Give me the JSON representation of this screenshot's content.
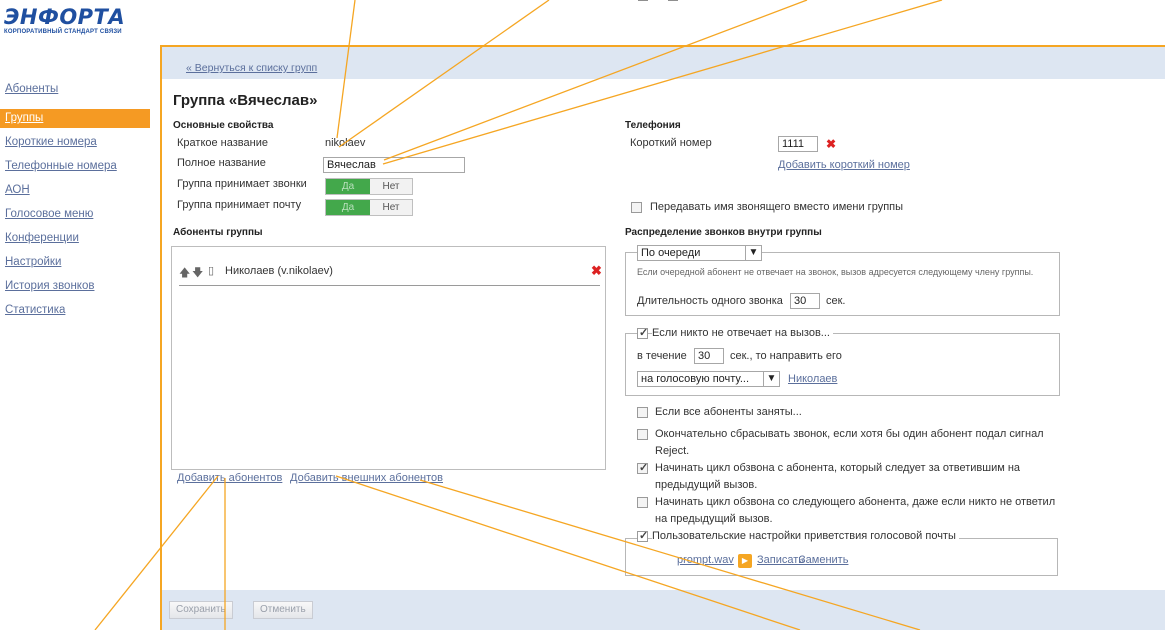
{
  "brand": {
    "logo_text": "ЭНФОРТА",
    "logo_tagline": "КОРПОРАТИВНЫЙ СТАНДАРТ СВЯЗИ",
    "accent_color": "#f5a623",
    "brand_color": "#1f4fa0"
  },
  "sidebar": {
    "items": [
      {
        "label": "Абоненты",
        "active": false
      },
      {
        "label": "Группы",
        "active": true
      },
      {
        "label": "Короткие номера",
        "active": false
      },
      {
        "label": "Телефонные номера",
        "active": false
      },
      {
        "label": "АОН",
        "active": false
      },
      {
        "label": "Голосовое меню",
        "active": false
      },
      {
        "label": "Конференции",
        "active": false
      },
      {
        "label": "Настройки",
        "active": false
      },
      {
        "label": "История звонков",
        "active": false
      },
      {
        "label": "Статистика",
        "active": false
      }
    ]
  },
  "topbar": {
    "back_link": "« Вернуться к списку групп"
  },
  "page": {
    "title": "Группа «Вячеслав»"
  },
  "basic": {
    "section_title": "Основные свойства",
    "short_name_label": "Краткое название",
    "short_name_value": "nikolaev",
    "full_name_label": "Полное название",
    "full_name_value": "Вячеслав",
    "accepts_calls_label": "Группа принимает звонки",
    "accepts_mail_label": "Группа принимает почту",
    "toggle_yes": "Да",
    "toggle_no": "Нет"
  },
  "members": {
    "section_title": "Абоненты группы",
    "list": [
      {
        "name": "Николаев (v.nikolaev)"
      }
    ],
    "add_members_link": "Добавить абонентов",
    "add_external_link": "Добавить внешних абонентов"
  },
  "telephony": {
    "section_title": "Телефония",
    "short_number_label": "Короткий номер",
    "short_number_value": "1111",
    "add_short_number_link": "Добавить короткий номер",
    "pass_caller_name_label": "Передавать имя звонящего вместо имени группы"
  },
  "distribution": {
    "section_title": "Распределение звонков внутри группы",
    "mode_value": "По очереди",
    "mode_note": "Если очередной абонент не отвечает на звонок, вызов адресуется следующему члену группы.",
    "ring_duration_label": "Длительность одного звонка",
    "ring_duration_value": "30",
    "ring_duration_unit": "сек.",
    "no_answer_label": "Если никто не отвечает на вызов...",
    "within_label": "в течение",
    "within_value": "30",
    "then_redirect_label": "сек.,  то направить его",
    "redirect_target": "на голосовую почту...",
    "redirect_user_link": "Николаев",
    "all_busy_label": "Если все абоненты заняты...",
    "reject_label_1": "Окончательно сбрасывать звонок, если хотя бы один абонент подал сигнал",
    "reject_label_2": "Reject.",
    "cycle_after_answered_1": "Начинать цикл обзвона с абонента, который следует за ответившим на",
    "cycle_after_answered_2": "предыдущий вызов.",
    "cycle_next_1": "Начинать цикл обзвона со следующего абонента, даже если никто не ответил",
    "cycle_next_2": "на предыдущий вызов.",
    "custom_greeting_label": "Пользовательские настройки приветствия голосовой почты",
    "prompt_file_link": "prompt.wav",
    "record_link": "Записать",
    "replace_link": "Заменить"
  },
  "footer": {
    "save_label": "Сохранить",
    "cancel_label": "Отменить"
  }
}
